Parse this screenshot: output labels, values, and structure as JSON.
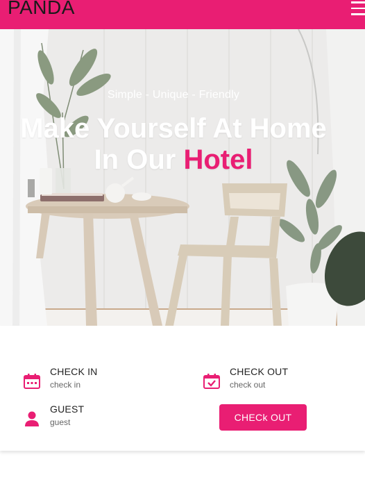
{
  "header": {
    "logo": "PANDA",
    "menu_icon": "hamburger-menu-icon"
  },
  "hero": {
    "tagline": "Simple - Unique - Friendly",
    "headline_line1": "Make Yourself At Home",
    "headline_line2_prefix": "In Our ",
    "headline_line2_accent": "Hotel"
  },
  "booking": {
    "check_in": {
      "label": "CHECK IN",
      "value": "check in",
      "icon": "calendar-icon"
    },
    "check_out": {
      "label": "CHECK OUT",
      "value": "check out",
      "icon": "calendar-check-icon"
    },
    "guest": {
      "label": "GUEST",
      "value": "guest",
      "icon": "person-icon"
    },
    "button_label": "CHECk OUT"
  },
  "colors": {
    "brand": "#e91e73",
    "logo_text": "#1a1a1a",
    "hero_bg": "#ebebea"
  }
}
